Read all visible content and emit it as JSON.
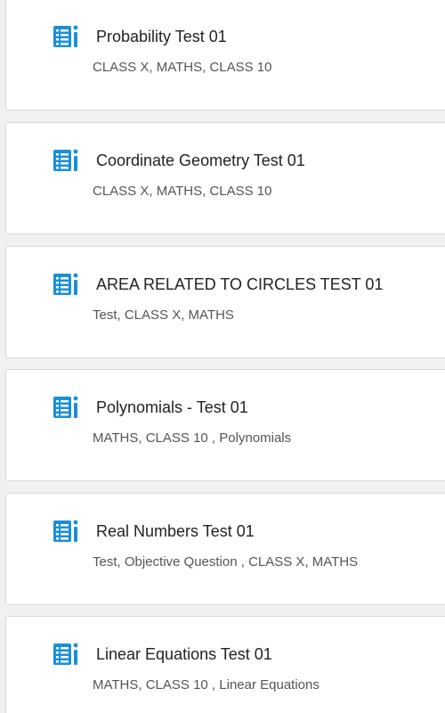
{
  "accent_color": "#1a8fd8",
  "tests": [
    {
      "title": "Probability Test 01",
      "tags": "CLASS X, MATHS, CLASS 10",
      "icon": "test-list-icon"
    },
    {
      "title": "Coordinate Geometry Test 01",
      "tags": "CLASS X, MATHS, CLASS 10",
      "icon": "test-list-icon"
    },
    {
      "title": "AREA RELATED TO CIRCLES TEST 01",
      "tags": "Test, CLASS X, MATHS",
      "icon": "test-list-icon"
    },
    {
      "title": "Polynomials - Test 01",
      "tags": "MATHS, CLASS 10 , Polynomials",
      "icon": "test-list-icon"
    },
    {
      "title": "Real Numbers Test 01",
      "tags": "Test, Objective Question , CLASS X, MATHS",
      "icon": "test-list-icon"
    },
    {
      "title": "Linear Equations Test 01",
      "tags": "MATHS, CLASS 10 , Linear Equations",
      "icon": "test-list-icon"
    }
  ]
}
